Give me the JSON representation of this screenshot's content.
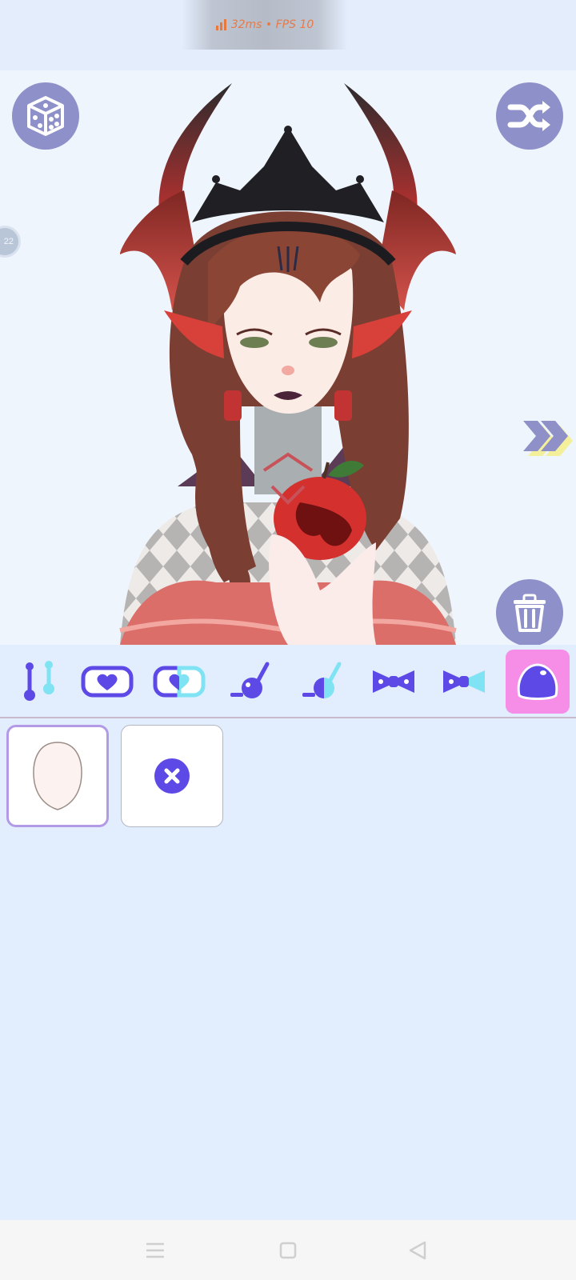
{
  "status": {
    "perf_text": "32ms • FPS 10"
  },
  "stage": {
    "side_badge": "22"
  },
  "toolbar": {
    "tools": [
      {
        "name": "sticks"
      },
      {
        "name": "heart-badge"
      },
      {
        "name": "heart-badge-alt"
      },
      {
        "name": "orb-wand"
      },
      {
        "name": "orb-wand-alt"
      },
      {
        "name": "bow"
      },
      {
        "name": "bow-alt"
      },
      {
        "name": "blob"
      }
    ],
    "active_index": 7
  },
  "options": [
    {
      "name": "face-shape",
      "selected": true
    },
    {
      "name": "none",
      "selected": false
    }
  ],
  "colors": {
    "accent": "#5c49e6",
    "accent_light": "#7fe3f3",
    "active_tool_bg": "#f68ee8",
    "round_button": "#8e90c9",
    "selected_border": "#b39ae6"
  }
}
